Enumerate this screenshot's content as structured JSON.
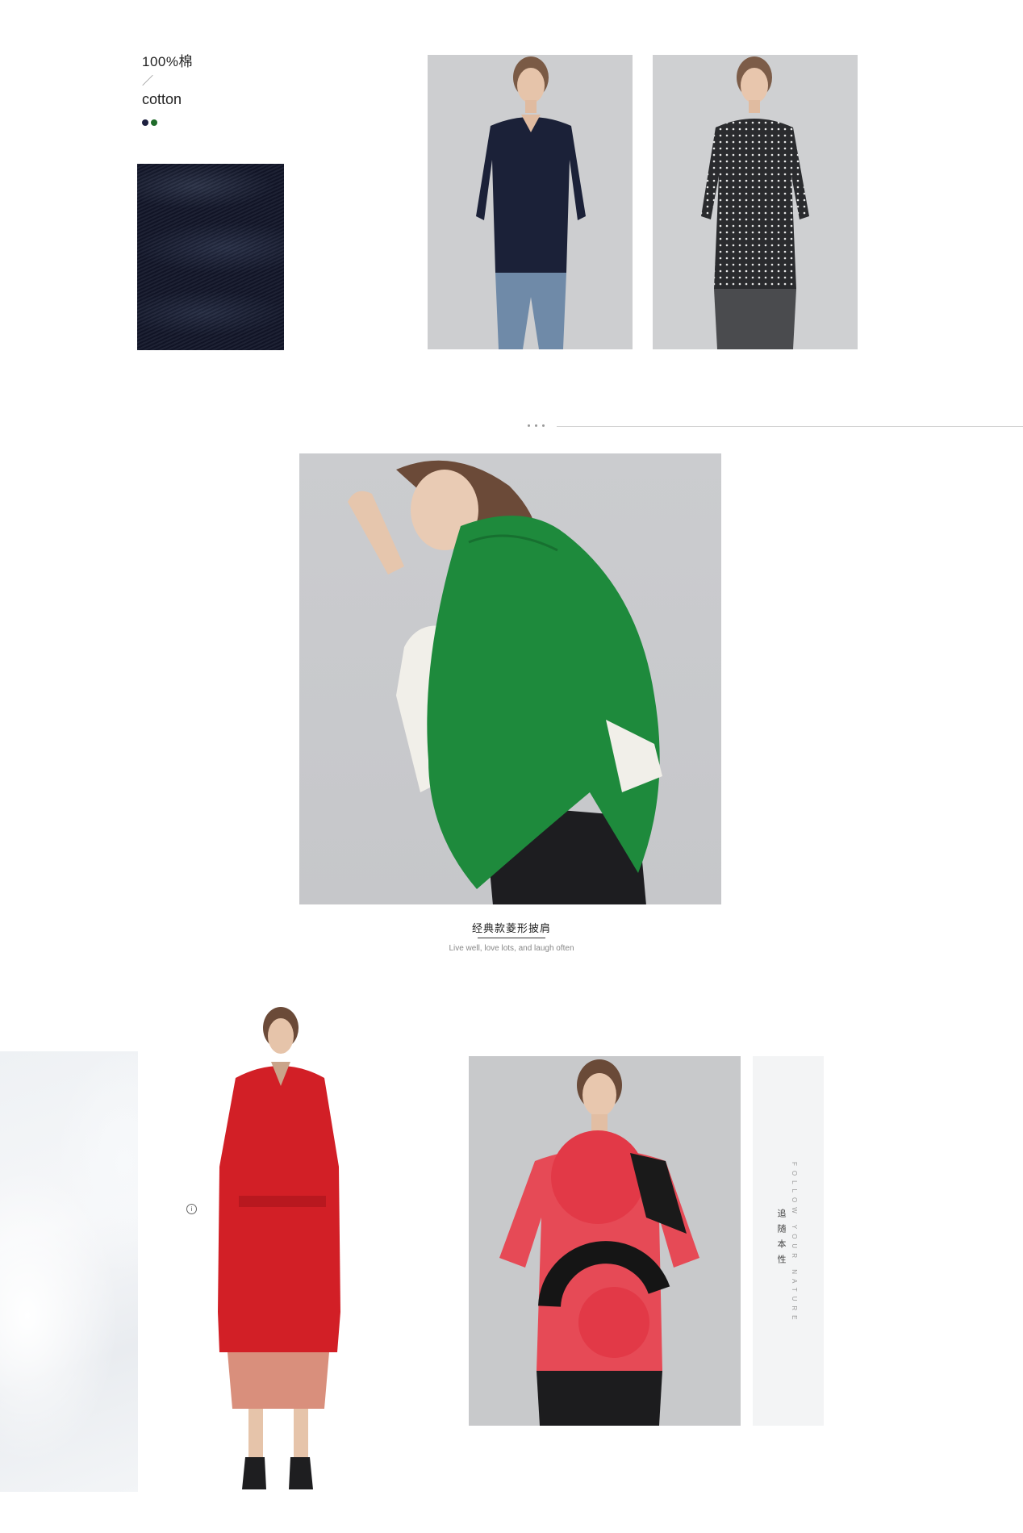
{
  "material": {
    "percent": "100%棉",
    "slash": "／",
    "name": "cotton",
    "swatch_colors": [
      "#1e2140",
      "#1f6b2a"
    ]
  },
  "images": {
    "fabric": "navy knit fabric close-up",
    "sweater": "model in navy v-neck sweater",
    "blouse": "model in polka dot blouse",
    "poncho": "model in green knit poncho",
    "coat": "model in red wool coat",
    "tshirt": "model in abstract print silk top",
    "silk": "white silk fabric"
  },
  "caption": {
    "title": "经典款菱形披肩",
    "subtitle": "Live well, love lots, and laugh often"
  },
  "side": {
    "english": "FOLLOW YOUR NATURE",
    "chinese": "追随本性"
  },
  "icons": {
    "info": "info-icon"
  }
}
